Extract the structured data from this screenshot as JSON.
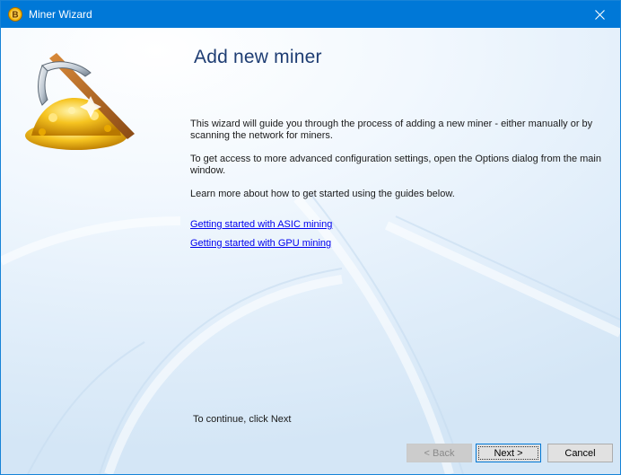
{
  "window": {
    "title": "Miner Wizard",
    "accent_color": "#0078d7",
    "icon": "bitcoin-coin-icon",
    "close_icon": "close-icon"
  },
  "main": {
    "heading": "Add new miner",
    "hero_icon": "pickaxe-gold-icon",
    "paragraphs": [
      "This wizard will guide you through the process of adding a new miner - either manually or by scanning the network for miners.",
      "To get access to more advanced configuration settings, open the Options dialog from the main window.",
      "Learn more about how to get started using the guides below."
    ],
    "links": [
      "Getting started with ASIC mining",
      "Getting started with GPU mining"
    ],
    "continue_text": "To continue, click Next"
  },
  "buttons": {
    "back": "< Back",
    "next": "Next >",
    "cancel": "Cancel"
  }
}
